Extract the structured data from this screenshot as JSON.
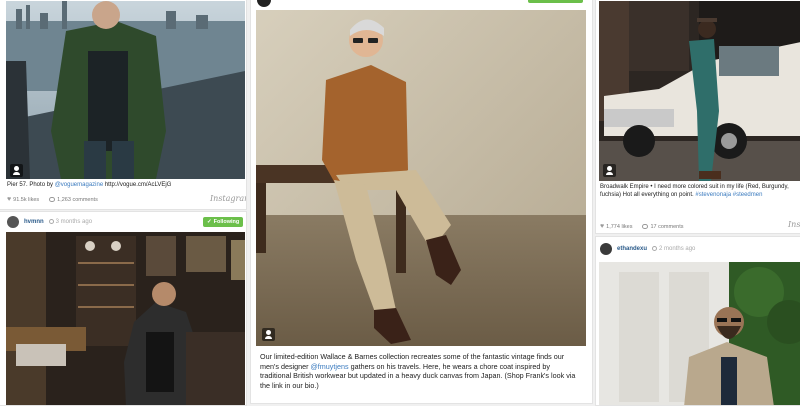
{
  "cards": {
    "left_top": {
      "caption_prefix": "Pier 57. Photo by ",
      "caption_handle": "@voguemagazine",
      "caption_suffix": " http://vogue.cm/AcLVEjG",
      "likes": "91.5k likes",
      "comments": "1,263 comments",
      "logo": "Instagram"
    },
    "left_bottom": {
      "username": "hvmnn",
      "time_ago": "3 months ago",
      "follow_label": "Following"
    },
    "center": {
      "caption_1": "Our limited-edition Wallace & Barnes collection recreates some of the fantastic vintage finds our men's designer ",
      "caption_handle": "@fmuytjens",
      "caption_2": " gathers on his travels. Here, he wears a chore coat inspired by traditional British workwear but updated in a heavy duck canvas from Japan. (Shop Frank's look via the link in our bio.)"
    },
    "right_top": {
      "caption": "Broadwalk Empire • I need more colored suit in my life (Red, Burgundy, fuchsia) Hot all everything on point.",
      "caption_tags": "#stevenonaja #steedmen",
      "likes": "1,774 likes",
      "comments": "17 comments",
      "logo": "Instagram"
    },
    "right_bottom": {
      "username": "ethandexu",
      "time_ago": "2 months ago"
    }
  },
  "colors": {
    "follow_green": "#6bbf4a",
    "link_blue": "#3b7bbf",
    "username_blue": "#2b5b8a"
  }
}
